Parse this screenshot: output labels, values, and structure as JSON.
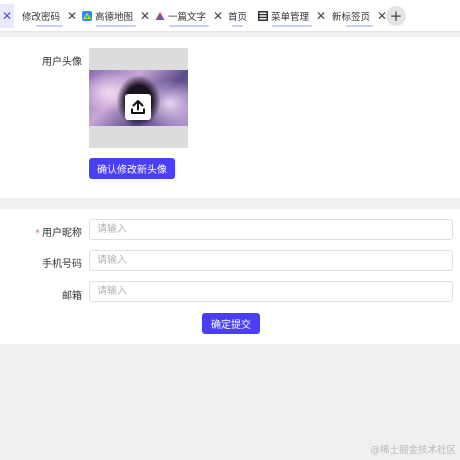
{
  "tabs": [
    {
      "label": "修改密码",
      "icon": "none"
    },
    {
      "label": "高德地图",
      "icon": "map-app-icon"
    },
    {
      "label": "一篇文字",
      "icon": "triangle-logo-icon"
    },
    {
      "label": "首页",
      "icon": "none"
    },
    {
      "label": "菜单管理",
      "icon": "menu-list-icon"
    },
    {
      "label": "新标签页",
      "icon": "none"
    }
  ],
  "close_glyph": "✕",
  "add_glyph": "+",
  "avatar_section": {
    "label": "用户头像",
    "confirm_button": "确认修改新头像"
  },
  "form": {
    "nickname": {
      "label": "用户昵称",
      "required_mark": "*",
      "placeholder": "请输入"
    },
    "phone": {
      "label": "手机号码",
      "placeholder": "请输入"
    },
    "email": {
      "label": "邮箱",
      "placeholder": "请输入"
    },
    "submit_button": "确定提交"
  },
  "watermark": "@稀土掘金技术社区",
  "colors": {
    "accent": "#4b3ff5",
    "required": "#f56c6c",
    "tab_underline": "#c9cdfa"
  }
}
